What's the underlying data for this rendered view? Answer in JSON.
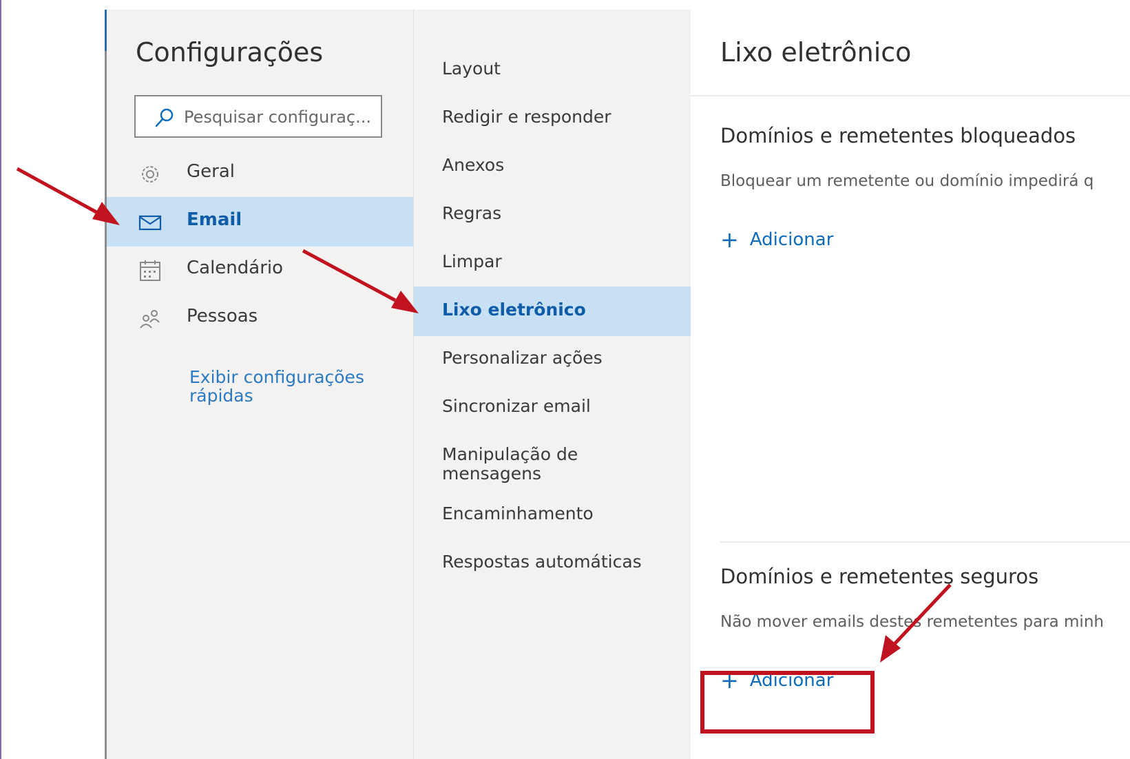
{
  "settings_nav": {
    "title": "Configurações",
    "search_placeholder": "Pesquisar configuraç...",
    "items": [
      {
        "label": "Geral",
        "icon": "gear-icon"
      },
      {
        "label": "Email",
        "icon": "mail-icon",
        "selected": true
      },
      {
        "label": "Calendário",
        "icon": "calendar-icon"
      },
      {
        "label": "Pessoas",
        "icon": "people-icon"
      }
    ],
    "quick_settings_link": "Exibir configurações rápidas"
  },
  "mail_settings": {
    "items": [
      {
        "label": "Layout"
      },
      {
        "label": "Redigir e responder"
      },
      {
        "label": "Anexos"
      },
      {
        "label": "Regras"
      },
      {
        "label": "Limpar"
      },
      {
        "label": "Lixo eletrônico",
        "selected": true
      },
      {
        "label": "Personalizar ações"
      },
      {
        "label": "Sincronizar email"
      },
      {
        "label": "Manipulação de mensagens"
      },
      {
        "label": "Encaminhamento"
      },
      {
        "label": "Respostas automáticas"
      }
    ]
  },
  "junk_email": {
    "title": "Lixo eletrônico",
    "blocked": {
      "heading": "Domínios e remetentes bloqueados",
      "description": "Bloquear um remetente ou domínio impedirá q",
      "add_label": "Adicionar"
    },
    "safe": {
      "heading": "Domínios e remetentes seguros",
      "description": "Não mover emails destes remetentes para minh",
      "add_label": "Adicionar"
    }
  },
  "colors": {
    "accent": "#0f6cbd",
    "selection": "#c7e0f4",
    "annotation": "#c1121f",
    "nav_background": "#f3f2f1"
  }
}
